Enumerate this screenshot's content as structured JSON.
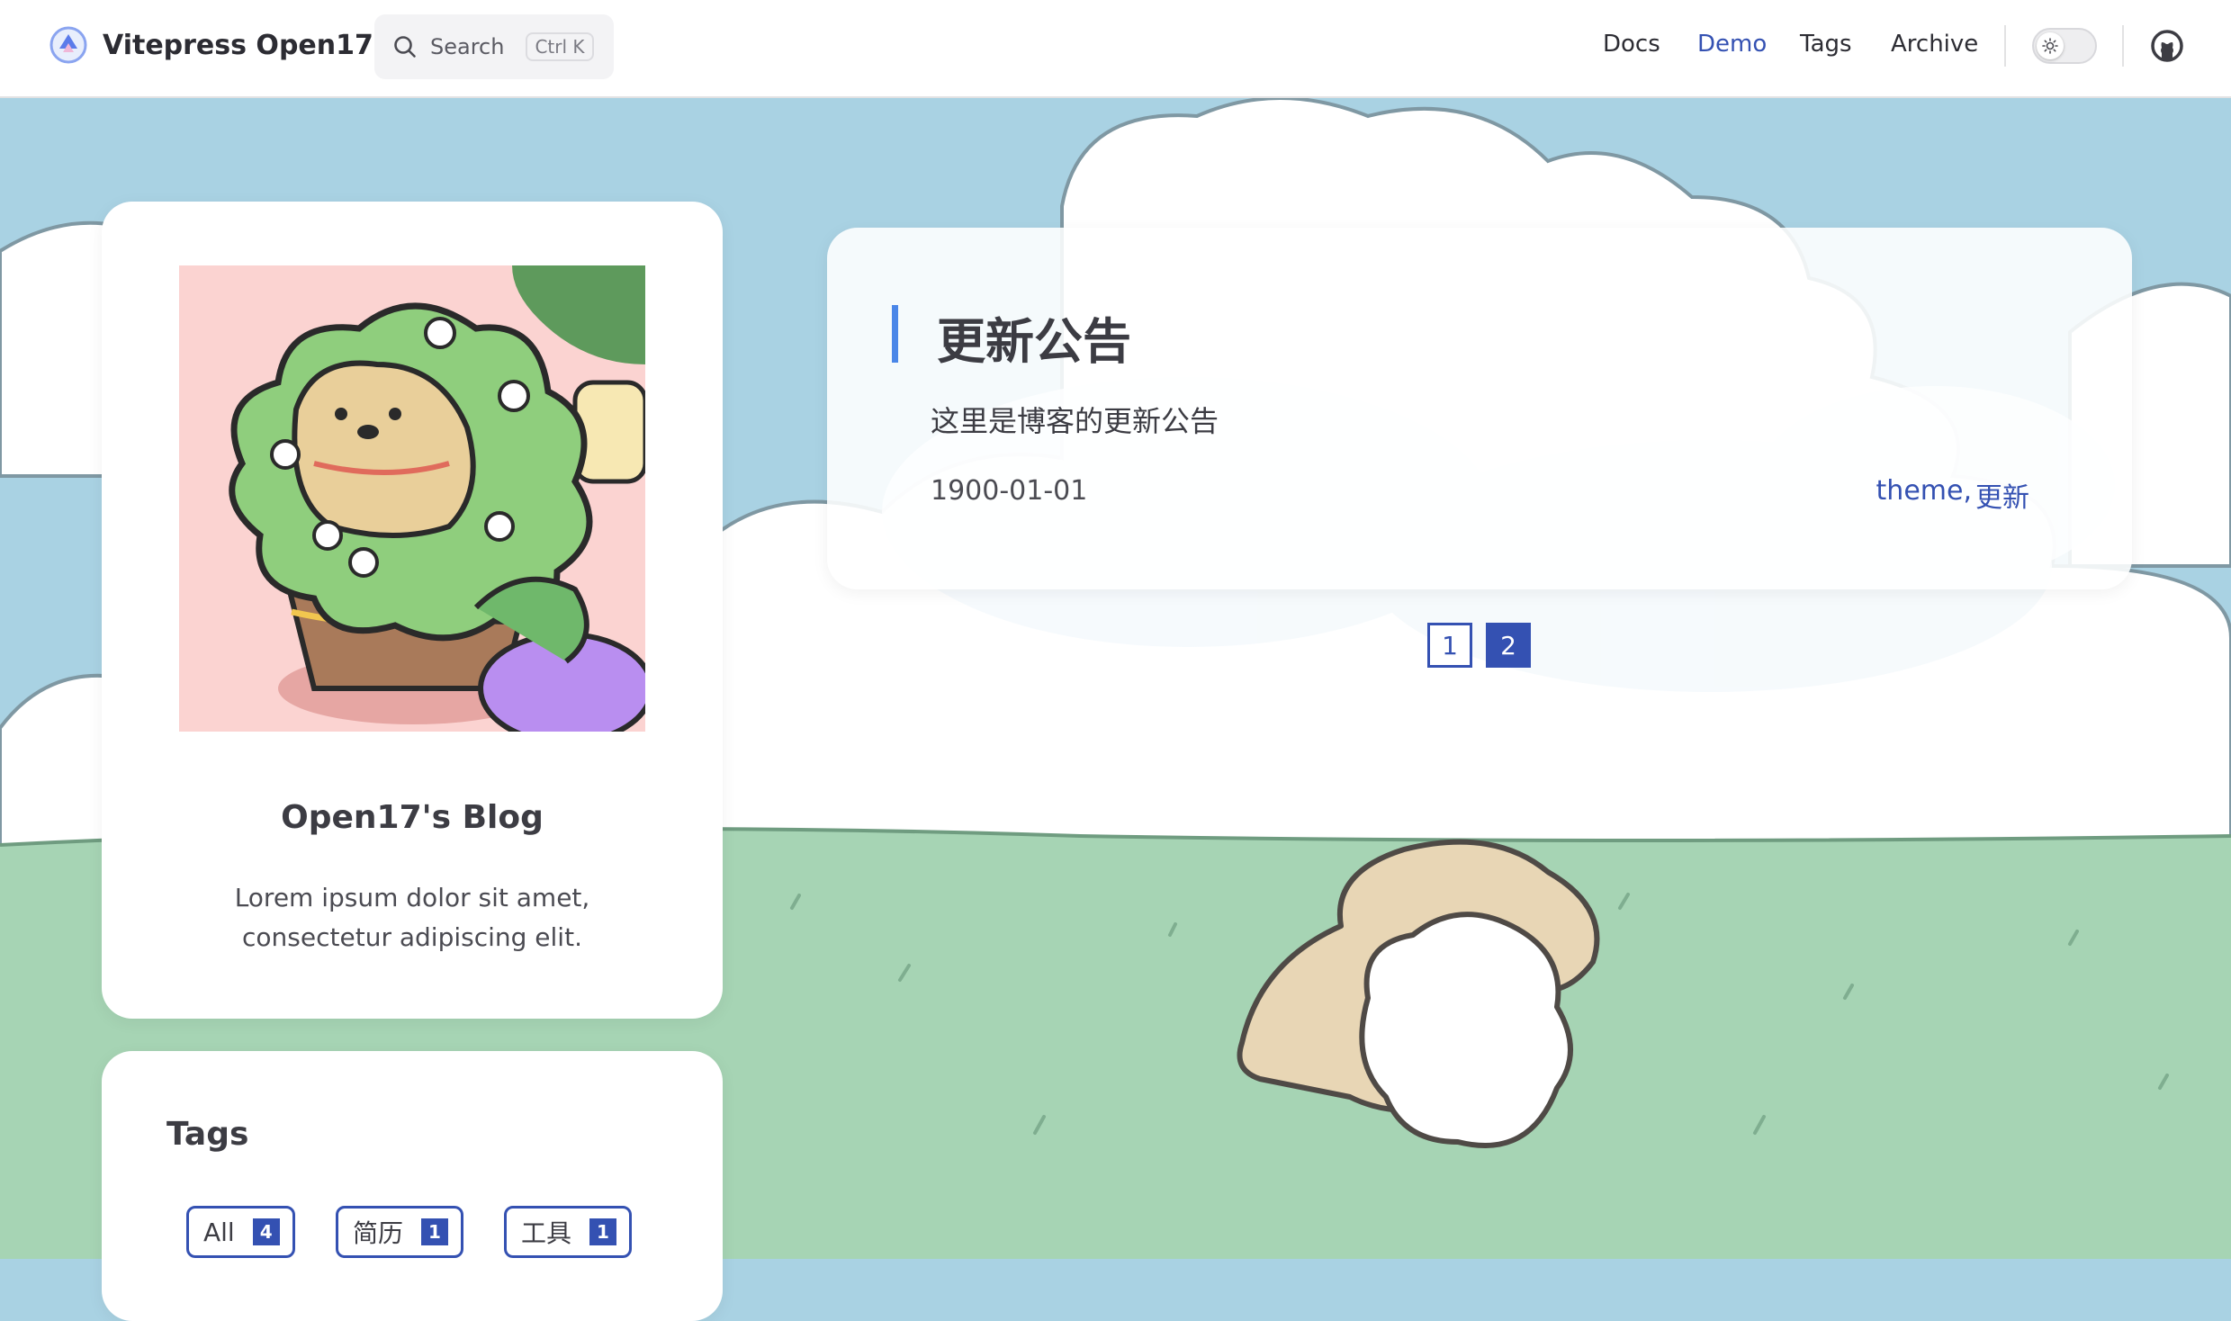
{
  "navbar": {
    "site_name": "Vitepress Open17",
    "search_label": "Search",
    "search_shortcut": "Ctrl K",
    "links": [
      {
        "label": "Docs",
        "active": false
      },
      {
        "label": "Demo",
        "active": true
      },
      {
        "label": "Tags",
        "active": false
      },
      {
        "label": "Archive",
        "active": false
      }
    ],
    "icons": {
      "logo": "logo-icon",
      "search": "search-icon",
      "theme": "sun-icon",
      "github": "github-icon"
    }
  },
  "profile": {
    "title": "Open17's Blog",
    "description": "Lorem ipsum dolor sit amet, consectetur adipiscing elit."
  },
  "tags": {
    "title": "Tags",
    "items": [
      {
        "name": "All",
        "count": "4"
      },
      {
        "name": "简历",
        "count": "1"
      },
      {
        "name": "工具",
        "count": "1"
      }
    ]
  },
  "post": {
    "title": "更新公告",
    "excerpt": "这里是博客的更新公告",
    "date": "1900-01-01",
    "tags": [
      "theme,",
      "更新"
    ]
  },
  "pagination": {
    "pages": [
      "1",
      "2"
    ],
    "current": "2"
  },
  "colors": {
    "accent": "#3451b2",
    "sky": "#a9d2e3",
    "grass": "#a6d4b4",
    "title_bar": "#4a86e8"
  }
}
